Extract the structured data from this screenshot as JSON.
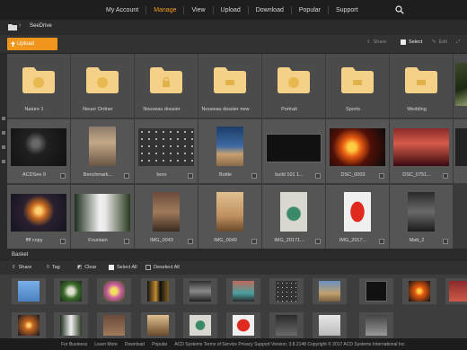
{
  "nav": {
    "links": [
      "My Account",
      "Manage",
      "View",
      "Upload",
      "Download",
      "Popular",
      "Support"
    ],
    "active": "Manage"
  },
  "breadcrumb": {
    "root": "SeeDrive"
  },
  "toolbar": {
    "upload": "Upload",
    "share": "Share",
    "select": "Select",
    "edit": "Edit"
  },
  "folders": [
    "Nature 1",
    "Neuer Ordner",
    "Nouveau dossier",
    "Nouveau dossier new",
    "Portrait",
    "Sports",
    "Wedding"
  ],
  "files_row2": [
    "ACDSee 9",
    "Benchmark...",
    "boro",
    "Bottle",
    "build 101 1...",
    "DSC_0003",
    "DSC_0751..."
  ],
  "files_row3": [
    "ffff copy",
    "Fountain",
    "IMG_0043",
    "IMG_0049",
    "IMG_20171...",
    "IMG_2017...",
    "Matt_2"
  ],
  "basket": {
    "title": "Basket",
    "share": "Share",
    "tag": "Tag",
    "clear": "Clear",
    "select_all": "Select All",
    "deselect_all": "Deselect All"
  },
  "footer": {
    "items": [
      "For Business",
      "Learn More",
      "Download",
      "Popular",
      "ACD Systems Terms of Service Privacy Support Version: 3.8.2148 Copyright © 2017 ACD Systems International Inc."
    ]
  },
  "colors": {
    "accent": "#f0961c",
    "folder": "#f4d089"
  }
}
